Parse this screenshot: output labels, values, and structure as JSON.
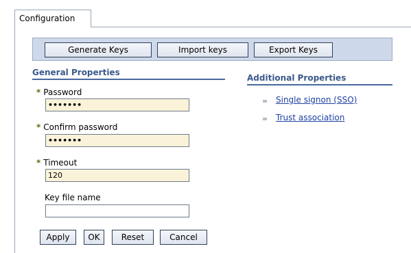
{
  "tab": {
    "label": "Configuration"
  },
  "toolbar": {
    "generate_keys": "Generate Keys",
    "import_keys": "Import keys",
    "export_keys": "Export Keys"
  },
  "general_properties": {
    "title": "General Properties",
    "password": {
      "label": "Password",
      "value": "•••••••",
      "required": true
    },
    "confirm_password": {
      "label": "Confirm password",
      "value": "•••••••",
      "required": true
    },
    "timeout": {
      "label": "Timeout",
      "value": "120",
      "required": true
    },
    "key_file_name": {
      "label": "Key file name",
      "value": "",
      "required": false
    }
  },
  "additional_properties": {
    "title": "Additional Properties",
    "links": [
      {
        "label": "Single signon (SSO)"
      },
      {
        "label": "Trust association"
      }
    ]
  },
  "required_marker": "*",
  "actions": {
    "apply": "Apply",
    "ok": "OK",
    "reset": "Reset",
    "cancel": "Cancel"
  },
  "colors": {
    "toolbar_bg": "#cdd8ea",
    "section_title": "#3a5a8c",
    "link": "#1c3fa3",
    "required_field_bg": "#fbf3d9",
    "required_marker": "#5d6e14"
  }
}
